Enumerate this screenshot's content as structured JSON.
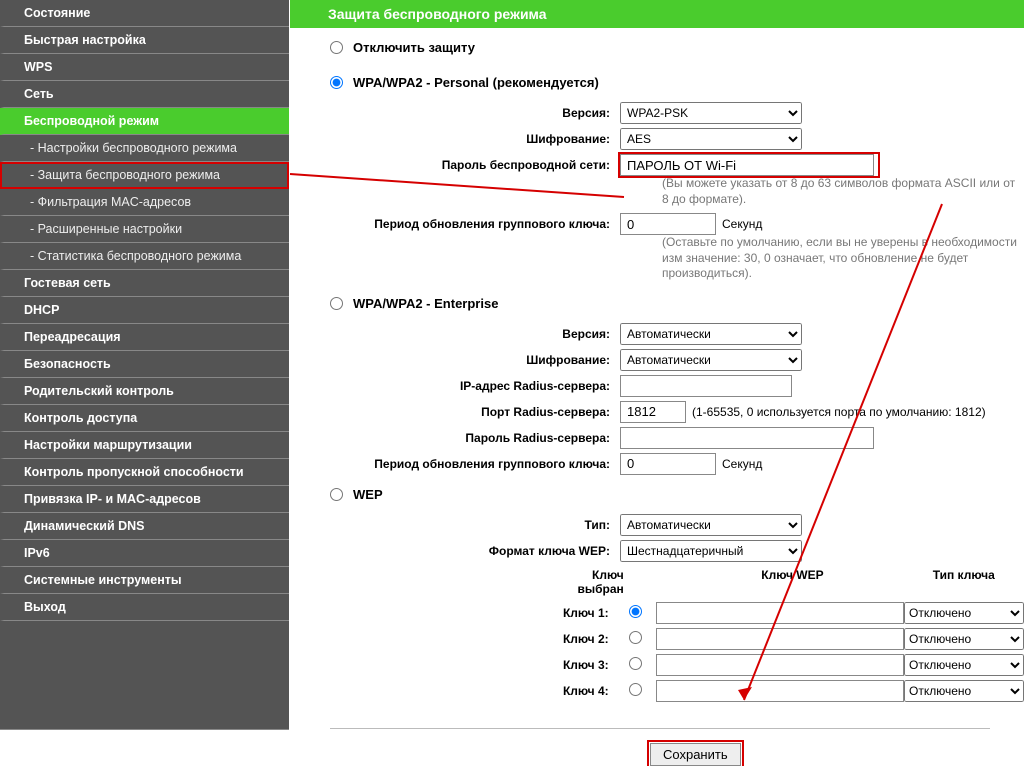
{
  "sidebar": {
    "items": [
      {
        "label": "Состояние",
        "sub": false,
        "active": false,
        "hl": false
      },
      {
        "label": "Быстрая настройка",
        "sub": false,
        "active": false,
        "hl": false
      },
      {
        "label": "WPS",
        "sub": false,
        "active": false,
        "hl": false
      },
      {
        "label": "Сеть",
        "sub": false,
        "active": false,
        "hl": false
      },
      {
        "label": "Беспроводной режим",
        "sub": false,
        "active": true,
        "hl": false
      },
      {
        "label": "- Настройки беспроводного режима",
        "sub": true,
        "active": false,
        "hl": false
      },
      {
        "label": "- Защита беспроводного режима",
        "sub": true,
        "active": false,
        "hl": true
      },
      {
        "label": "- Фильтрация MAC-адресов",
        "sub": true,
        "active": false,
        "hl": false
      },
      {
        "label": "- Расширенные настройки",
        "sub": true,
        "active": false,
        "hl": false
      },
      {
        "label": "- Статистика беспроводного режима",
        "sub": true,
        "active": false,
        "hl": false
      },
      {
        "label": "Гостевая сеть",
        "sub": false,
        "active": false,
        "hl": false
      },
      {
        "label": "DHCP",
        "sub": false,
        "active": false,
        "hl": false
      },
      {
        "label": "Переадресация",
        "sub": false,
        "active": false,
        "hl": false
      },
      {
        "label": "Безопасность",
        "sub": false,
        "active": false,
        "hl": false
      },
      {
        "label": "Родительский контроль",
        "sub": false,
        "active": false,
        "hl": false
      },
      {
        "label": "Контроль доступа",
        "sub": false,
        "active": false,
        "hl": false
      },
      {
        "label": "Настройки маршрутизации",
        "sub": false,
        "active": false,
        "hl": false
      },
      {
        "label": "Контроль пропускной способности",
        "sub": false,
        "active": false,
        "hl": false
      },
      {
        "label": "Привязка IP- и MAC-адресов",
        "sub": false,
        "active": false,
        "hl": false
      },
      {
        "label": "Динамический DNS",
        "sub": false,
        "active": false,
        "hl": false
      },
      {
        "label": "IPv6",
        "sub": false,
        "active": false,
        "hl": false
      },
      {
        "label": "Системные инструменты",
        "sub": false,
        "active": false,
        "hl": false
      },
      {
        "label": "Выход",
        "sub": false,
        "active": false,
        "hl": false
      }
    ]
  },
  "page": {
    "title": "Защита беспроводного режима",
    "opt_disable": "Отключить защиту",
    "opt_wpa_personal": "WPA/WPA2 - Personal (рекомендуется)",
    "opt_wpa_enterprise": "WPA/WPA2 - Enterprise",
    "opt_wep": "WEP"
  },
  "wpa_p": {
    "version_label": "Версия:",
    "version_value": "WPA2-PSK",
    "enc_label": "Шифрование:",
    "enc_value": "AES",
    "pwd_label": "Пароль беспроводной сети:",
    "pwd_value": "ПАРОЛЬ ОТ Wi-Fi",
    "pwd_hint": "(Вы можете указать от 8 до 63 символов формата ASCII или от 8 до формате).",
    "gk_label": "Период обновления группового ключа:",
    "gk_value": "0",
    "gk_unit": "Секунд",
    "gk_hint": "(Оставьте по умолчанию, если вы не уверены в необходимости изм значение: 30, 0 означает, что обновление не будет производиться)."
  },
  "wpa_e": {
    "version_label": "Версия:",
    "version_value": "Автоматически",
    "enc_label": "Шифрование:",
    "enc_value": "Автоматически",
    "radius_ip_label": "IP-адрес Radius-сервера:",
    "radius_ip_value": "",
    "radius_port_label": "Порт Radius-сервера:",
    "radius_port_value": "1812",
    "radius_port_hint": "(1-65535, 0 используется порта по умолчанию: 1812)",
    "radius_pwd_label": "Пароль Radius-сервера:",
    "radius_pwd_value": "",
    "gk_label": "Период обновления группового ключа:",
    "gk_value": "0",
    "gk_unit": "Секунд"
  },
  "wep": {
    "type_label": "Тип:",
    "type_value": "Автоматически",
    "fmt_label": "Формат ключа WEP:",
    "fmt_value": "Шестнадцатеричный",
    "head_sel": "Ключ выбран",
    "head_key": "Ключ WEP",
    "head_type": "Тип ключа",
    "rows": [
      {
        "label": "Ключ 1:",
        "type": "Отключено"
      },
      {
        "label": "Ключ 2:",
        "type": "Отключено"
      },
      {
        "label": "Ключ 3:",
        "type": "Отключено"
      },
      {
        "label": "Ключ 4:",
        "type": "Отключено"
      }
    ]
  },
  "save": {
    "label": "Сохранить"
  }
}
